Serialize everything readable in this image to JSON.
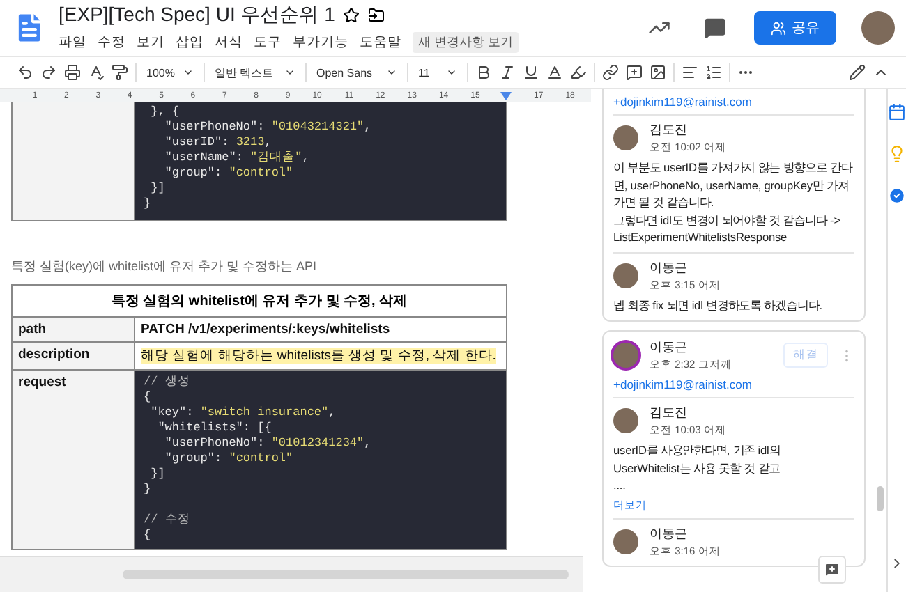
{
  "header": {
    "title": "[EXP][Tech Spec] UI 우선순위 1",
    "menus": [
      "파일",
      "수정",
      "보기",
      "삽입",
      "서식",
      "도구",
      "부가기능",
      "도움말"
    ],
    "changes_button": "새 변경사항 보기",
    "share_button": "공유"
  },
  "toolbar": {
    "zoom": "100%",
    "style": "일반 텍스트",
    "font": "Open Sans",
    "size": "11"
  },
  "ruler": [
    {
      "kind": "num",
      "label": "1"
    },
    {
      "kind": "num",
      "label": "2"
    },
    {
      "kind": "num",
      "label": "3"
    },
    {
      "kind": "num",
      "label": "4"
    },
    {
      "kind": "num",
      "label": "5"
    },
    {
      "kind": "num",
      "label": "6"
    },
    {
      "kind": "num",
      "label": "7"
    },
    {
      "kind": "num",
      "label": "8"
    },
    {
      "kind": "num",
      "label": "9"
    },
    {
      "kind": "num",
      "label": "10"
    },
    {
      "kind": "num",
      "label": "11"
    },
    {
      "kind": "num",
      "label": "12"
    },
    {
      "kind": "num",
      "label": "13"
    },
    {
      "kind": "num",
      "label": "14"
    },
    {
      "kind": "num",
      "label": "15"
    },
    {
      "kind": "marker"
    },
    {
      "kind": "num",
      "label": "17"
    },
    {
      "kind": "num",
      "label": "18"
    }
  ],
  "document": {
    "code_top": [
      " }, {",
      "   \"userPhoneNo\": \"01043214321\",",
      "   \"userID\": 3213,",
      "   \"userName\": \"김대출\",",
      "   \"group\": \"control\"",
      " }]",
      "}"
    ],
    "caption": "특정 실험(key)에 whitelist에 유저 추가 및 수정하는 API",
    "table": {
      "title": "특정 실험의 whitelist에 유저 추가 및 수정, 삭제",
      "rows": [
        {
          "label": "path",
          "kind": "text",
          "value": "PATCH  /v1/experiments/:keys/whitelists"
        },
        {
          "label": "description",
          "kind": "highlight",
          "value": "해당 실험에 해당하는 whitelists를 생성 및 수정, 삭제 한다."
        },
        {
          "label": "request",
          "kind": "code",
          "blocks": [
            [
              "// 생성",
              "{",
              " \"key\": \"switch_insurance\",",
              "  \"whitelists\": [{",
              "   \"userPhoneNo\": \"01012341234\",",
              "   \"group\": \"control\"",
              " }]",
              "}"
            ],
            [
              "// 수정",
              "{"
            ]
          ]
        }
      ]
    }
  },
  "comments": [
    {
      "mention": "+dojinkim119@rainist.com",
      "replies": [
        {
          "author": "김도진",
          "time": "오전 10:02 어제",
          "text": "이 부분도 userID를 가져가지 않는 방향으로 간다면, userPhoneNo, userName, groupKey만 가져가면 될 것 같습니다.\n그렇다면 idl도 변경이 되어야할 것 같습니다 -> ListExperimentWhitelistsResponse"
        },
        {
          "author": "이동근",
          "time": "오후 3:15 어제",
          "text": "넵 최종 fix 되면 idl 변경하도록 하겠습니다."
        }
      ]
    },
    {
      "author": "이동근",
      "time": "오후 2:32 그저께",
      "resolve": "해결",
      "mention": "+dojinkim119@rainist.com",
      "replies": [
        {
          "author": "김도진",
          "time": "오전 10:03 어제",
          "text": "userID를 사용안한다면, 기존 idl의\nUserWhitelist는 사용 못할 것 같고\n....",
          "more": "더보기"
        },
        {
          "author": "이동근",
          "time": "오후 3:16 어제"
        }
      ]
    }
  ]
}
